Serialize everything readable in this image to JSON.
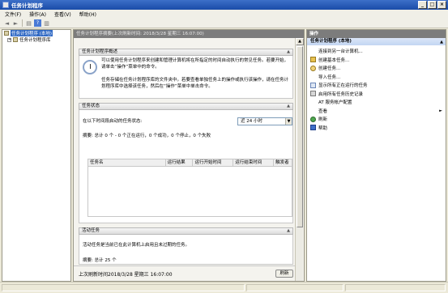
{
  "window": {
    "title": "任务计划程序",
    "buttons": {
      "minimize": "_",
      "maximize": "□",
      "close": "×"
    }
  },
  "menubar": [
    "文件(F)",
    "操作(A)",
    "查看(V)",
    "帮助(H)"
  ],
  "toolbar": {
    "back_icon": "back-arrow-icon",
    "forward_icon": "forward-arrow-icon",
    "help_glyph": "?"
  },
  "tree": {
    "root_label": "任务计划程序 (本地)",
    "child_label": "任务计划程序库"
  },
  "center": {
    "header": "任务计划程序摘要(上次刷新时间: 2018/3/28 星期三 16:07:00)",
    "overview": {
      "title": "任务计划程序概述",
      "para1": "可以使用任务计划程序来创建和管理计算机将在所指定的时间自动执行的常见任务。若要开始，请单击“操作”菜单中的命令。",
      "para2": "任务存储在任务计划程序库的文件夹中。若要查看单独任务上的操作或执行该操作，请在任务计划程序库中选择该任务，然后在“操作”菜单中单击命令。"
    },
    "status": {
      "title": "任务状态",
      "filter_label": "在以下时间段启动的任务状态:",
      "filter_value": "近 24 小时",
      "summary": "摘要: 总计 0 个 - 0 个正在运行，0 个成功，0 个停止，0 个失败",
      "columns": [
        "任务名",
        "运行结果",
        "运行开始时间",
        "运行结束时间",
        "触发者"
      ]
    },
    "active": {
      "title": "活动任务",
      "desc": "活动任务是当前已在此计算机上启用且未过期的任务。",
      "summary": "摘要: 总计 25 个"
    },
    "last_refresh": "上次刷新时间2018/3/28 星期三 16:07:00",
    "refresh_button": "刷新"
  },
  "actions": {
    "header": "操作",
    "section": "任务计划程序 (本地)",
    "items": [
      {
        "label": "连接到另一台计算机...",
        "icon": "none"
      },
      {
        "label": "创建基本任务...",
        "icon": "create-basic-task-icon"
      },
      {
        "label": "创建任务...",
        "icon": "create-task-icon"
      },
      {
        "label": "导入任务...",
        "icon": "none"
      },
      {
        "label": "显示所有正在运行的任务",
        "icon": "running-tasks-icon"
      },
      {
        "label": "启用所有任务历史记录",
        "icon": "history-icon"
      },
      {
        "label": "AT 服务帐户配置",
        "icon": "none"
      },
      {
        "label": "查看",
        "icon": "none",
        "submenu": true
      },
      {
        "label": "刷新",
        "icon": "refresh-icon"
      },
      {
        "label": "帮助",
        "icon": "help-icon"
      }
    ]
  },
  "colors": {
    "titlebar": "#1a4ca8",
    "header_gray": "#7c7c7c",
    "selection": "#316ac5",
    "actions_section": "#c2d5f2"
  }
}
